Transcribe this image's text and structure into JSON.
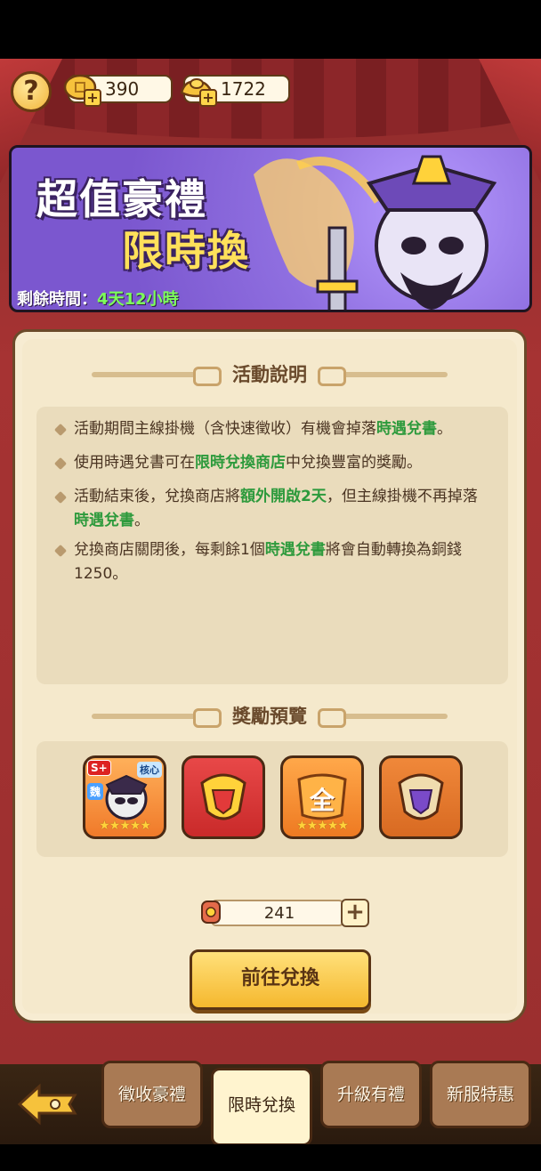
{
  "currencies": [
    {
      "icon": "gold-coin-icon",
      "value": "390"
    },
    {
      "icon": "gold-ingot-icon",
      "value": "1722"
    }
  ],
  "help": {
    "label": "?"
  },
  "banner": {
    "title_line1": "超值豪禮",
    "title_line2": "限時換",
    "time_label": "剩餘時間：",
    "time_value": "4天12小時"
  },
  "description": {
    "heading": "活動說明",
    "bullets": [
      {
        "parts": [
          "活動期間主線掛機（含快速徵收）有機會掉落",
          "時遇兌書",
          "。"
        ]
      },
      {
        "parts": [
          "使用時遇兌書可在",
          "限時兌換商店",
          "中兌換豐富的獎勵。"
        ]
      },
      {
        "parts": [
          "活動結束後，兌換商店將",
          "額外開啟2天",
          "，但主線掛機不再掉落",
          "時遇兌書",
          "。"
        ]
      },
      {
        "parts": [
          "兌換商店關閉後，每剩餘1個",
          "時遇兌書",
          "將會自動轉換為銅錢1250。"
        ]
      }
    ]
  },
  "rewards": {
    "heading": "獎勵預覽",
    "items": [
      {
        "name": "hero-card",
        "badge_rank": "S+",
        "badge_faction": "魏",
        "badge_tag": "核心",
        "stars": "★★★★★"
      },
      {
        "name": "red-shield-emblem",
        "stars": ""
      },
      {
        "name": "orange-all-token",
        "label": "全",
        "stars": "★★★★★"
      },
      {
        "name": "purple-shield-emblem",
        "stars": ""
      }
    ]
  },
  "exchange": {
    "item_count": "241",
    "plus_label": "+",
    "go_button": "前往兌換"
  },
  "nav": {
    "tabs": [
      "徵收豪禮",
      "限時兌換",
      "升級有禮",
      "新服特惠"
    ],
    "active_tab": "限時兌換"
  },
  "colors": {
    "highlight_green": "#2d9a3c",
    "banner_purple": "#7b57cf",
    "stage_red": "#a63333",
    "gold": "#f5b82e"
  }
}
